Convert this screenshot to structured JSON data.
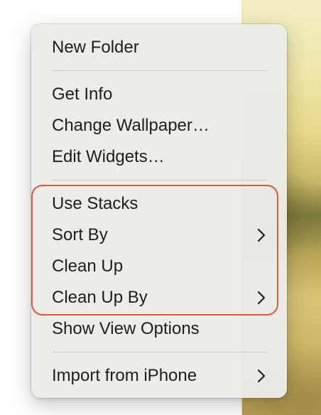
{
  "context_menu": {
    "items": [
      {
        "label": "New Folder",
        "submenu": false
      },
      {
        "label": "Get Info",
        "submenu": false
      },
      {
        "label": "Change Wallpaper…",
        "submenu": false
      },
      {
        "label": "Edit Widgets…",
        "submenu": false
      },
      {
        "label": "Use Stacks",
        "submenu": false
      },
      {
        "label": "Sort By",
        "submenu": true,
        "icon": "chevron-right-icon"
      },
      {
        "label": "Clean Up",
        "submenu": false
      },
      {
        "label": "Clean Up By",
        "submenu": true,
        "icon": "chevron-right-icon"
      },
      {
        "label": "Show View Options",
        "submenu": false
      },
      {
        "label": "Import from iPhone",
        "submenu": true,
        "icon": "chevron-right-icon"
      }
    ]
  },
  "annotation": {
    "highlight_color": "#d9583e"
  }
}
